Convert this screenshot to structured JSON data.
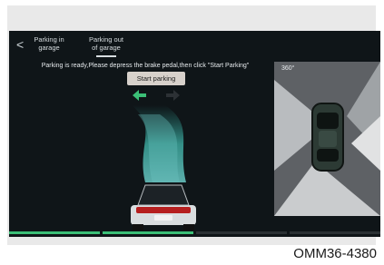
{
  "top_nav": {
    "back_label": "<",
    "tabs": [
      {
        "label_line1": "Parking in",
        "label_line2": "garage"
      },
      {
        "label_line1": "Parking out",
        "label_line2": "of garage"
      }
    ],
    "selected_tab_index": 1
  },
  "status_message": "Parking is ready,Please depress the brake pedal,then click \"Start Parking\"",
  "start_button_label": "Start parking",
  "direction_arrows": {
    "left_icon": "arrow-left-icon",
    "right_icon": "arrow-right-icon"
  },
  "camera_view": {
    "icon_label": "360°",
    "icon_name": "rotate-camera-icon"
  },
  "progress": {
    "filled_segments": 2,
    "total_segments": 4
  },
  "colors": {
    "accent": "#3bbf77",
    "screen_bg": "#0f1518",
    "button_bg": "#d7d1cb"
  },
  "figure_code": "OMM36-4380"
}
